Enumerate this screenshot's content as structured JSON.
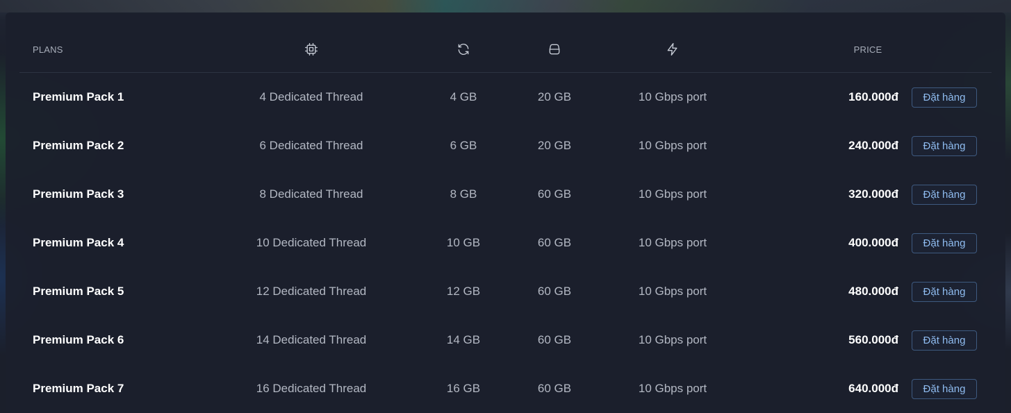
{
  "table": {
    "headers": {
      "plans": "PLANS",
      "cpu_icon": "cpu-icon",
      "ram_icon": "refresh-icon",
      "disk_icon": "disk-icon",
      "network_icon": "lightning-icon",
      "price": "PRICE"
    },
    "rows": [
      {
        "name": "Premium Pack 1",
        "cpu": "4 Dedicated Thread",
        "ram": "4 GB",
        "disk": "20 GB",
        "network": "10 Gbps port",
        "price": "160.000đ",
        "button": "Đặt hàng"
      },
      {
        "name": "Premium Pack 2",
        "cpu": "6 Dedicated Thread",
        "ram": "6 GB",
        "disk": "20 GB",
        "network": "10 Gbps port",
        "price": "240.000đ",
        "button": "Đặt hàng"
      },
      {
        "name": "Premium Pack 3",
        "cpu": "8 Dedicated Thread",
        "ram": "8 GB",
        "disk": "60 GB",
        "network": "10 Gbps port",
        "price": "320.000đ",
        "button": "Đặt hàng"
      },
      {
        "name": "Premium Pack 4",
        "cpu": "10 Dedicated Thread",
        "ram": "10 GB",
        "disk": "60 GB",
        "network": "10 Gbps port",
        "price": "400.000đ",
        "button": "Đặt hàng"
      },
      {
        "name": "Premium Pack 5",
        "cpu": "12 Dedicated Thread",
        "ram": "12 GB",
        "disk": "60 GB",
        "network": "10 Gbps port",
        "price": "480.000đ",
        "button": "Đặt hàng"
      },
      {
        "name": "Premium Pack 6",
        "cpu": "14 Dedicated Thread",
        "ram": "14 GB",
        "disk": "60 GB",
        "network": "10 Gbps port",
        "price": "560.000đ",
        "button": "Đặt hàng"
      },
      {
        "name": "Premium Pack 7",
        "cpu": "16 Dedicated Thread",
        "ram": "16 GB",
        "disk": "60 GB",
        "network": "10 Gbps port",
        "price": "640.000đ",
        "button": "Đặt hàng"
      }
    ]
  },
  "colors": {
    "background": "#1b1f2b",
    "button_border": "#3e5a80",
    "button_text": "#8fbcf0",
    "spec_text": "#b3b8c3"
  }
}
